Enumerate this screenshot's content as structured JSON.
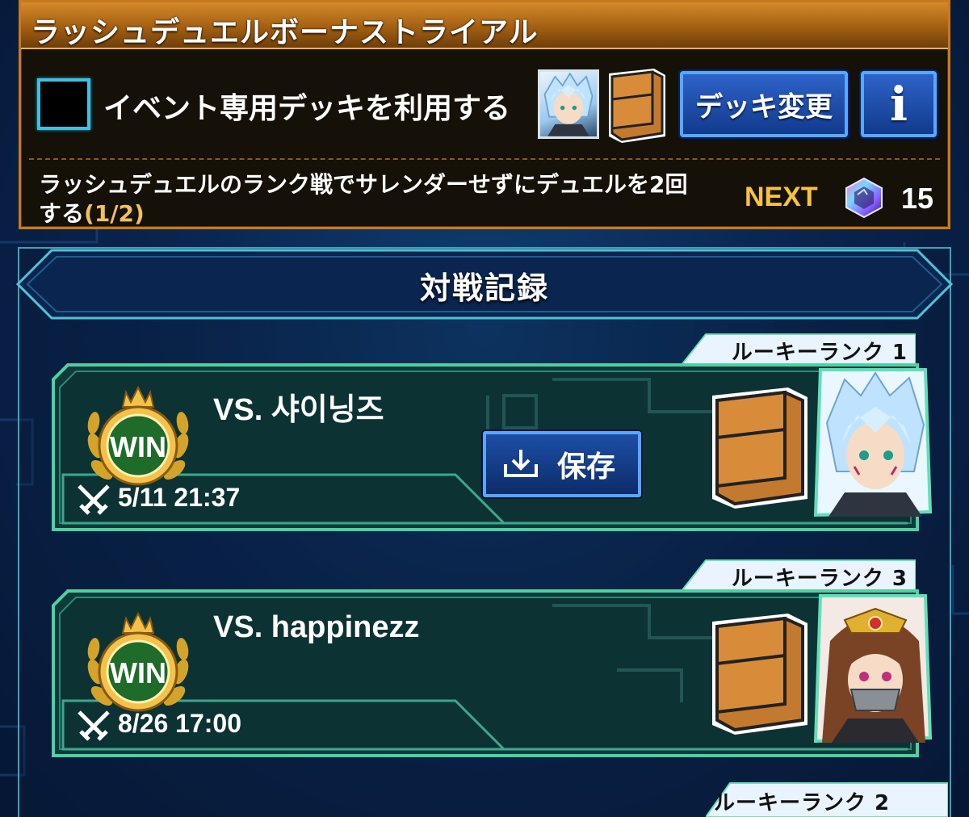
{
  "trial": {
    "title": "ラッシュデュエルボーナストライアル",
    "use_event_deck_label": "イベント専用デッキを利用する",
    "deck_change_label": "デッキ変更",
    "info_label": "i",
    "mission_text": "ラッシュデュエルのランク戦でサレンダーせずにデュエルを2回する",
    "mission_progress": "(1/2)",
    "next_label": "NEXT",
    "reward_icon": "gem-icon",
    "reward_count": "15"
  },
  "records": {
    "title": "対戦記録",
    "items": [
      {
        "rank": "ルーキーランク 1",
        "result": "WIN",
        "opponent": "VS. 샤이닝즈",
        "date": "5/11 21:37",
        "save_label": "保存",
        "avatar_icon": "avatar-silver-hair",
        "deck_icon": "deck-box-icon"
      },
      {
        "rank": "ルーキーランク 3",
        "result": "WIN",
        "opponent": "VS. happinezz",
        "date": "8/26 17:00",
        "avatar_icon": "avatar-brown-hair",
        "deck_icon": "deck-box-icon"
      },
      {
        "rank": "ルーキーランク 2"
      }
    ]
  },
  "colors": {
    "trial_border": "#c8791e",
    "record_frame": "#4fd0a0",
    "win_gold": "#f2c24a",
    "next_yellow": "#f6c33c",
    "button_blue": "#2d63c9"
  }
}
